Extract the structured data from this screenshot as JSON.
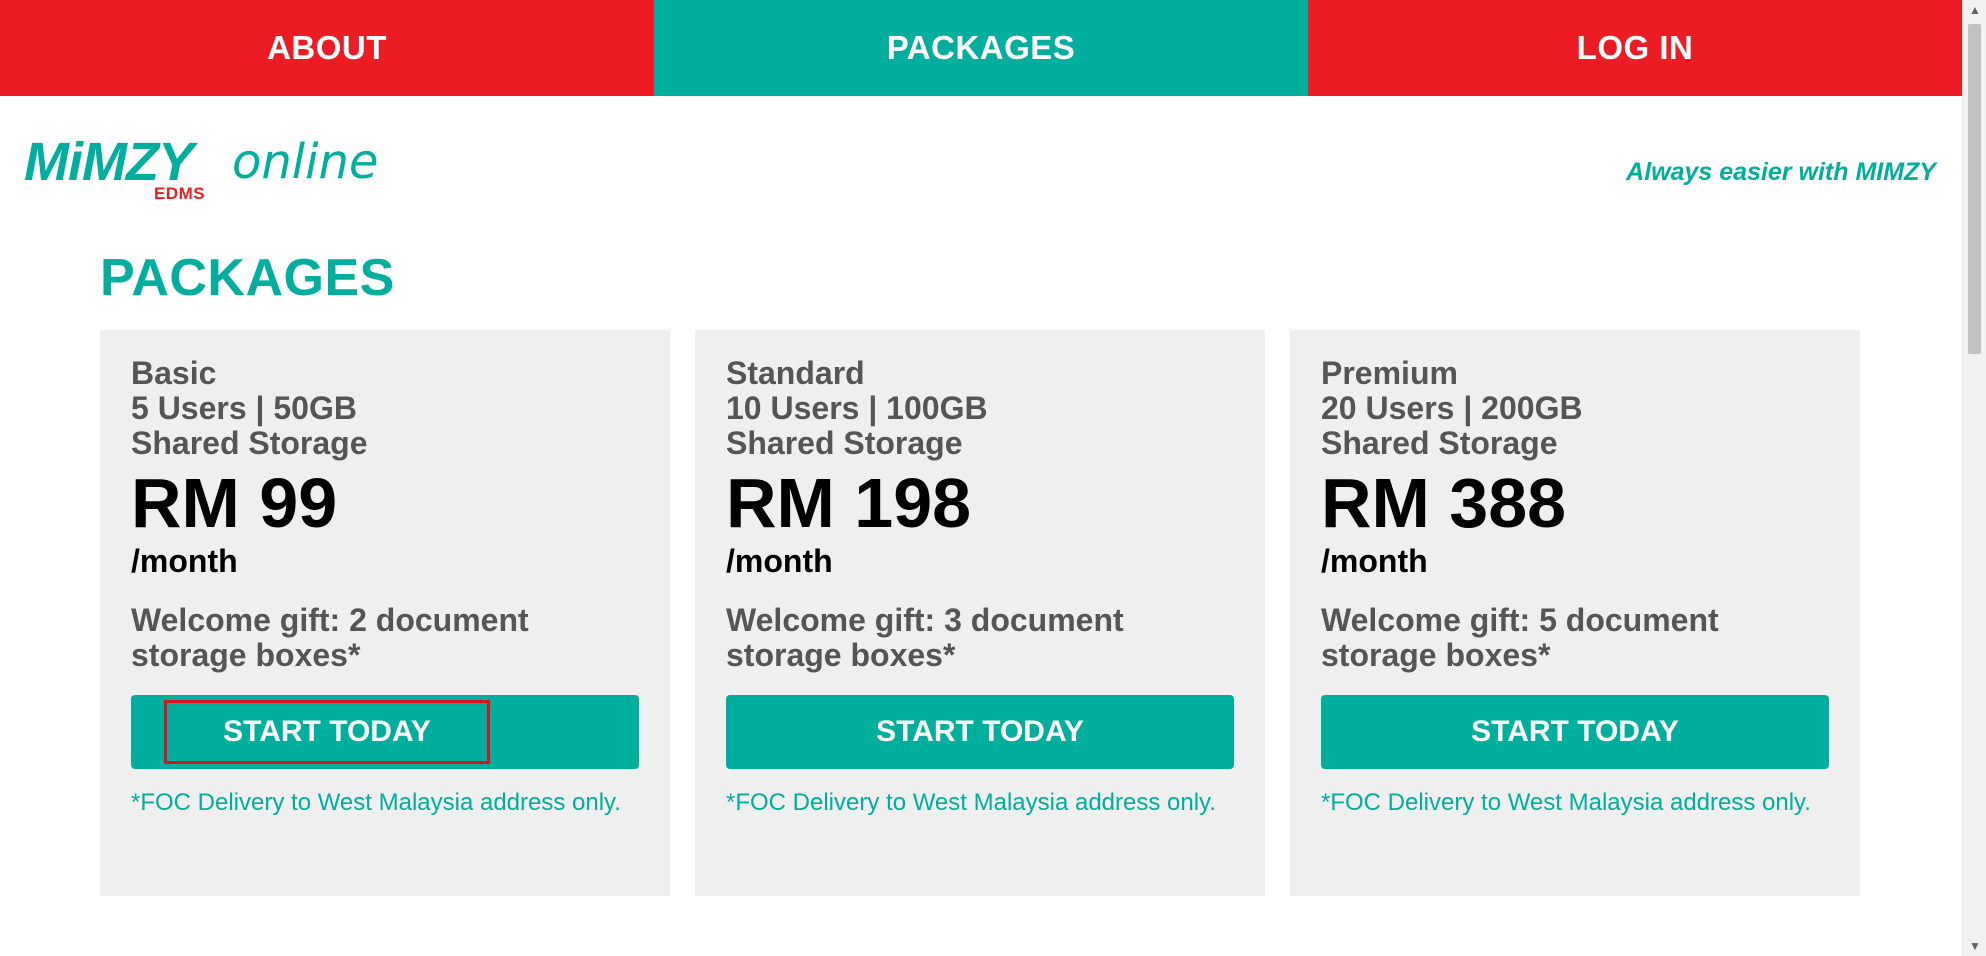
{
  "nav": {
    "items": [
      {
        "label": "ABOUT"
      },
      {
        "label": "PACKAGES"
      },
      {
        "label": "LOG IN"
      }
    ]
  },
  "header": {
    "logo": {
      "brand": "MiMZY",
      "suffix": "online",
      "sub": "EDMS"
    },
    "tagline": "Always easier with MIMZY"
  },
  "page": {
    "title": "PACKAGES"
  },
  "packages": [
    {
      "name": "Basic",
      "users": "5 Users | 50GB",
      "storage": "Shared Storage",
      "price": "RM 99",
      "period": "/month",
      "gift": "Welcome gift: 2 document storage boxes*",
      "button": "START TODAY",
      "note": "*FOC Delivery to West Malaysia address only."
    },
    {
      "name": "Standard",
      "users": "10 Users | 100GB",
      "storage": "Shared Storage",
      "price": "RM 198",
      "period": "/month",
      "gift": "Welcome gift: 3 document storage boxes*",
      "button": "START TODAY",
      "note": "*FOC Delivery to West Malaysia address only."
    },
    {
      "name": "Premium",
      "users": "20 Users | 200GB",
      "storage": "Shared Storage",
      "price": "RM 388",
      "period": "/month",
      "gift": "Welcome gift: 5 document storage boxes*",
      "button": "START TODAY",
      "note": "*FOC Delivery to West Malaysia address only."
    }
  ],
  "colors": {
    "brand_red": "#ed1c24",
    "brand_teal": "#00ae9d",
    "card_bg": "#efefef",
    "text_gray": "#555555"
  },
  "icons": {
    "scroll_up": "triangle-up-icon",
    "scroll_down": "triangle-down-icon"
  }
}
